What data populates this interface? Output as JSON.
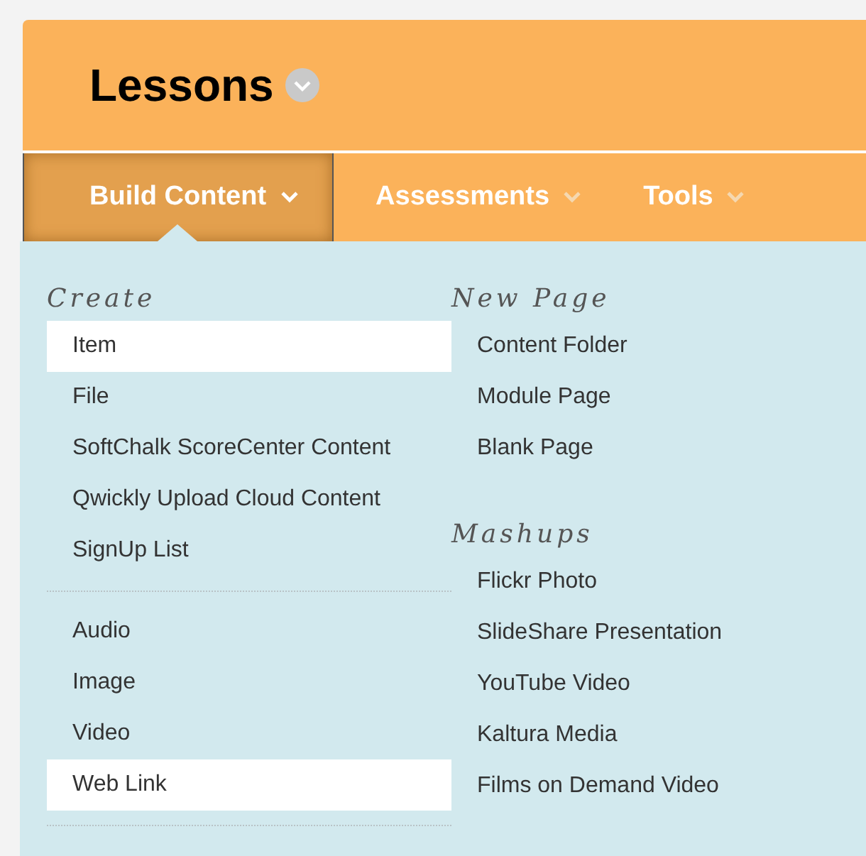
{
  "header": {
    "title": "Lessons"
  },
  "nav": {
    "tabs": [
      {
        "label": "Build Content",
        "selected": true
      },
      {
        "label": "Assessments",
        "selected": false
      },
      {
        "label": "Tools",
        "selected": false
      }
    ]
  },
  "menu": {
    "columns": [
      {
        "sections": [
          {
            "heading": "Create",
            "groups": [
              [
                {
                  "label": "Item",
                  "selected": true
                },
                {
                  "label": "File",
                  "selected": false
                },
                {
                  "label": "SoftChalk ScoreCenter Content",
                  "selected": false
                },
                {
                  "label": "Qwickly Upload Cloud Content",
                  "selected": false
                },
                {
                  "label": "SignUp List",
                  "selected": false
                }
              ],
              [
                {
                  "label": "Audio",
                  "selected": false
                },
                {
                  "label": "Image",
                  "selected": false
                },
                {
                  "label": "Video",
                  "selected": false
                },
                {
                  "label": "Web Link",
                  "selected": true
                }
              ]
            ]
          }
        ]
      },
      {
        "sections": [
          {
            "heading": "New Page",
            "groups": [
              [
                {
                  "label": "Content Folder",
                  "selected": false
                },
                {
                  "label": "Module Page",
                  "selected": false
                },
                {
                  "label": "Blank Page",
                  "selected": false
                }
              ]
            ]
          },
          {
            "heading": "Mashups",
            "groups": [
              [
                {
                  "label": "Flickr Photo",
                  "selected": false
                },
                {
                  "label": "SlideShare Presentation",
                  "selected": false
                },
                {
                  "label": "YouTube Video",
                  "selected": false
                },
                {
                  "label": "Kaltura Media",
                  "selected": false
                },
                {
                  "label": "Films on Demand Video",
                  "selected": false
                }
              ]
            ]
          }
        ]
      }
    ]
  }
}
